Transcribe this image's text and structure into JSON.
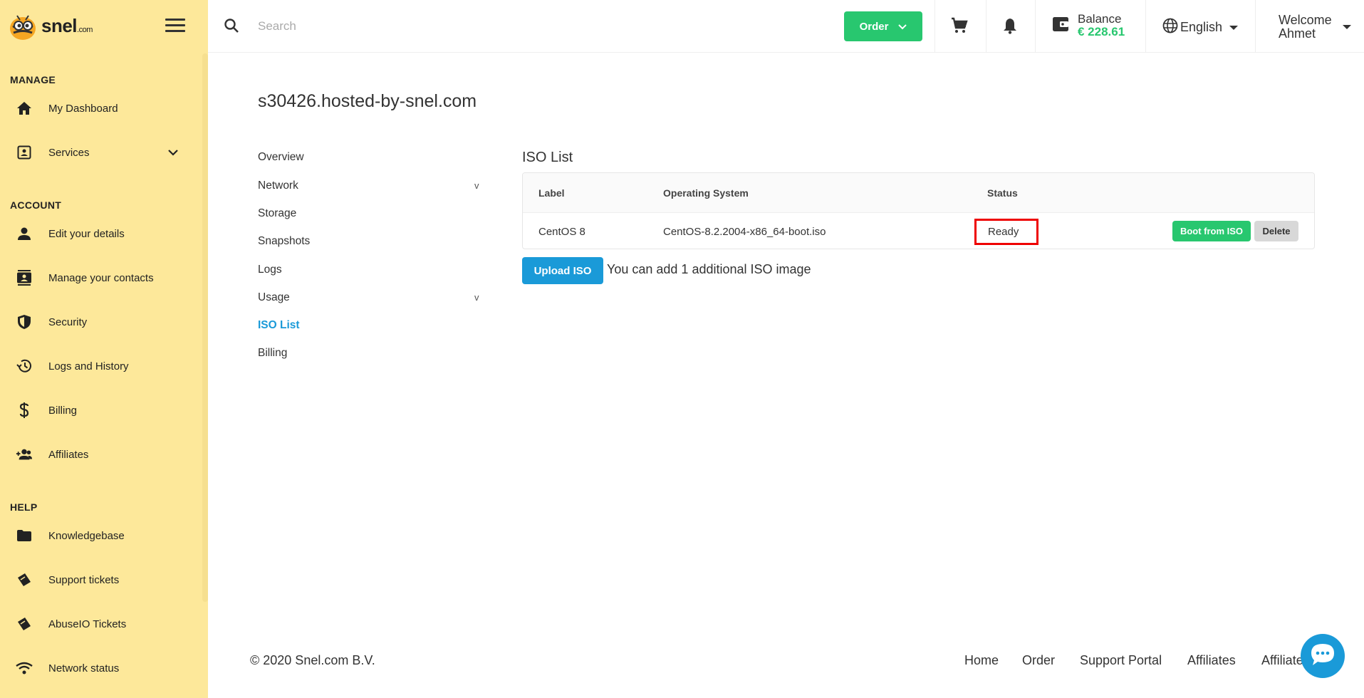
{
  "brand": {
    "name": "snel",
    "suffix": ".com"
  },
  "search": {
    "placeholder": "Search"
  },
  "topbar": {
    "order_label": "Order",
    "balance_label": "Balance",
    "balance_amount": "€ 228.61",
    "language": "English",
    "welcome_line1": "Welcome",
    "welcome_line2": "Ahmet"
  },
  "sidebar": {
    "sections": {
      "manage": "MANAGE",
      "account": "ACCOUNT",
      "help": "HELP"
    },
    "items": [
      {
        "label": "My Dashboard",
        "icon": "home-icon"
      },
      {
        "label": "Services",
        "icon": "contact-card-icon"
      },
      {
        "label": "Edit your details",
        "icon": "person-icon"
      },
      {
        "label": "Manage your contacts",
        "icon": "contacts-icon"
      },
      {
        "label": "Security",
        "icon": "shield-icon"
      },
      {
        "label": "Logs and History",
        "icon": "history-icon"
      },
      {
        "label": "Billing",
        "icon": "dollar-icon"
      },
      {
        "label": "Affiliates",
        "icon": "group-add-icon"
      },
      {
        "label": "Knowledgebase",
        "icon": "folder-icon"
      },
      {
        "label": "Support tickets",
        "icon": "ticket-icon"
      },
      {
        "label": "AbuseIO Tickets",
        "icon": "ticket-icon"
      },
      {
        "label": "Network status",
        "icon": "wifi-icon"
      }
    ]
  },
  "page": {
    "title": "s30426.hosted-by-snel.com",
    "subnav": [
      {
        "label": "Overview"
      },
      {
        "label": "Network",
        "expandable": "v"
      },
      {
        "label": "Storage"
      },
      {
        "label": "Snapshots"
      },
      {
        "label": "Logs"
      },
      {
        "label": "Usage",
        "expandable": "v"
      },
      {
        "label": "ISO List",
        "active": true
      },
      {
        "label": "Billing"
      }
    ]
  },
  "iso": {
    "title": "ISO List",
    "columns": [
      "Label",
      "Operating System",
      "Status"
    ],
    "rows": [
      {
        "label": "CentOS 8",
        "os": "CentOS-8.2.2004-x86_64-boot.iso",
        "status": "Ready"
      }
    ],
    "boot_label": "Boot from ISO",
    "delete_label": "Delete",
    "upload_label": "Upload ISO",
    "upload_note": "You can add 1 additional ISO image"
  },
  "footer": {
    "copyright": "© 2020 Snel.com B.V.",
    "links": [
      "Home",
      "Order",
      "Support Portal",
      "Affiliates",
      "Affiliate"
    ]
  },
  "colors": {
    "sidebar_bg": "#fde89a",
    "accent_green": "#28c76f",
    "accent_blue": "#1a9ad8",
    "highlight_red": "#e00000"
  }
}
